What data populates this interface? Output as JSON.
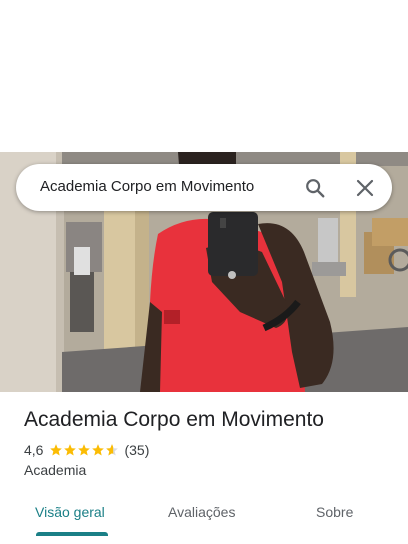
{
  "search": {
    "query": "Academia Corpo em Movimento",
    "search_icon": "search-icon",
    "close_icon": "close-icon"
  },
  "place": {
    "name": "Academia Corpo em Movimento",
    "rating": "4,6",
    "rating_value": 4.6,
    "review_count": "(35)",
    "category": "Academia"
  },
  "tabs": [
    {
      "label": "Visão geral",
      "active": true
    },
    {
      "label": "Avaliações",
      "active": false
    },
    {
      "label": "Sobre",
      "active": false
    }
  ],
  "colors": {
    "accent": "#1a7f86",
    "star": "#fbbc04",
    "shirt": "#e8323c"
  }
}
